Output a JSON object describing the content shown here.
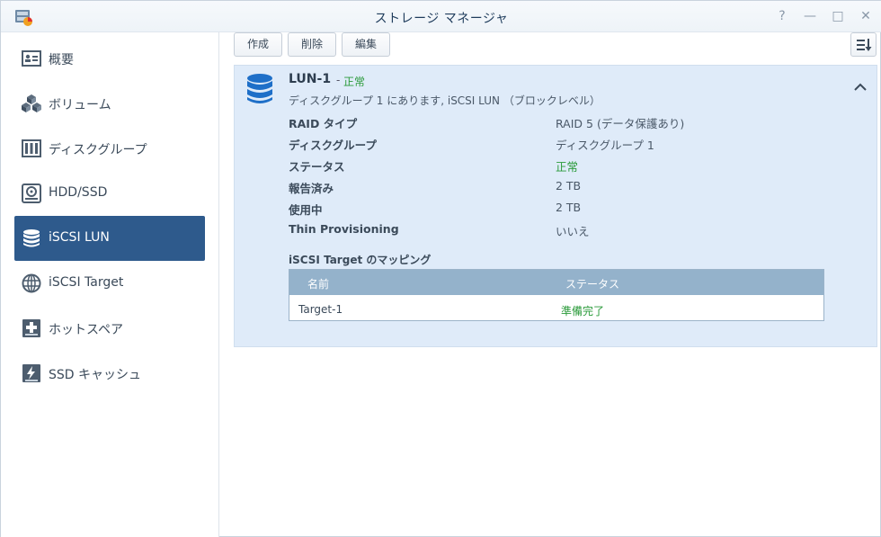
{
  "window": {
    "title": "ストレージ マネージャ",
    "controls": {
      "help": "?",
      "minimize": "—",
      "maximize": "□",
      "close": "✕"
    }
  },
  "sidebar": {
    "items": [
      {
        "label": "概要",
        "icon": "overview-icon",
        "active": false
      },
      {
        "label": "ボリューム",
        "icon": "volume-icon",
        "active": false
      },
      {
        "label": "ディスクグループ",
        "icon": "disk-group-icon",
        "active": false
      },
      {
        "label": "HDD/SSD",
        "icon": "hdd-icon",
        "active": false
      },
      {
        "label": "iSCSI LUN",
        "icon": "database-icon",
        "active": true
      },
      {
        "label": "iSCSI Target",
        "icon": "globe-icon",
        "active": false
      },
      {
        "label": "ホットスペア",
        "icon": "hot-spare-icon",
        "active": false
      },
      {
        "label": "SSD キャッシュ",
        "icon": "ssd-cache-icon",
        "active": false
      }
    ]
  },
  "toolbar": {
    "create": "作成",
    "delete": "削除",
    "edit": "編集"
  },
  "lun": {
    "name": "LUN-1",
    "separator": "-",
    "status": "正常",
    "description": "ディスクグループ 1 にあります, iSCSI LUN （ブロックレベル）",
    "details": [
      {
        "label": "RAID タイプ",
        "value": "RAID 5 (データ保護あり)",
        "ok": false
      },
      {
        "label": "ディスクグループ",
        "value": "ディスクグループ 1",
        "ok": false
      },
      {
        "label": "ステータス",
        "value": "正常",
        "ok": true
      },
      {
        "label": "報告済み",
        "value": "2 TB",
        "ok": false
      },
      {
        "label": "使用中",
        "value": "2 TB",
        "ok": false
      },
      {
        "label": "Thin Provisioning",
        "value": "いいえ",
        "ok": false
      }
    ],
    "mapping": {
      "title": "iSCSI Target のマッピング",
      "columns": [
        "名前",
        "ステータス"
      ],
      "rows": [
        {
          "name": "Target-1",
          "status": "準備完了"
        }
      ]
    }
  },
  "colors": {
    "accent": "#2e5a8c",
    "ok": "#2a9a3a",
    "panel": "#dfebf9",
    "table_header": "#94b2cb"
  }
}
